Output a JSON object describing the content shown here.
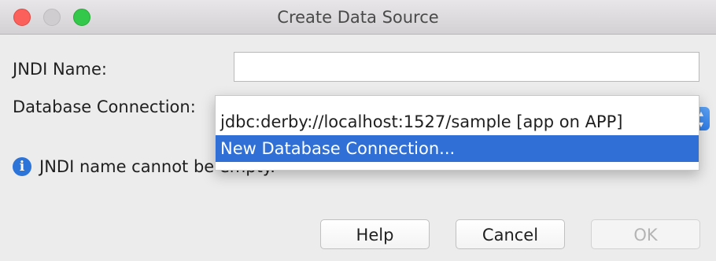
{
  "window": {
    "title": "Create Data Source"
  },
  "form": {
    "jndi_label": "JNDI Name:",
    "jndi_value": "",
    "connection_label": "Database Connection:"
  },
  "connection_dropdown": {
    "stepper_icon": "up-down-chevron-icon",
    "options": [
      "jdbc:derby://localhost:1527/sample [app on APP]",
      "New Database Connection..."
    ],
    "highlighted_index": 1
  },
  "message": {
    "icon": "info-icon",
    "text": "JNDI name cannot be empty."
  },
  "buttons": {
    "help": "Help",
    "cancel": "Cancel",
    "ok": "OK"
  },
  "colors": {
    "selection": "#2f6fd6",
    "close": "#fc605b",
    "zoom": "#34c84a",
    "info": "#2d74d8"
  }
}
